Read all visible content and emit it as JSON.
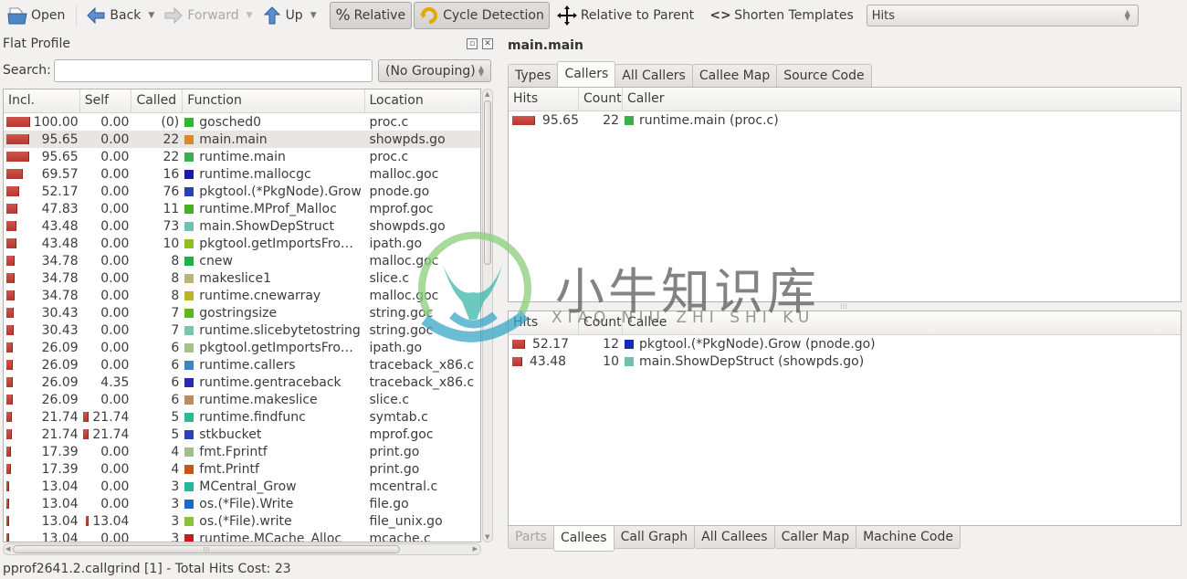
{
  "toolbar": {
    "open": "Open",
    "back": "Back",
    "forward": "Forward",
    "up": "Up",
    "relative": "Relative",
    "cycle_detection": "Cycle Detection",
    "relative_to_parent": "Relative to Parent",
    "shorten_templates": "Shorten Templates",
    "event_type": "Hits"
  },
  "flat_profile": {
    "title": "Flat Profile",
    "search_label": "Search:",
    "search_value": "",
    "grouping": "(No Grouping)",
    "columns": [
      "Incl.",
      "Self",
      "Called",
      "Function",
      "Location"
    ],
    "selected_row": 1,
    "rows": [
      {
        "incl": "100.00",
        "self": "0.00",
        "self_bar": 0,
        "called": "(0)",
        "function": "gosched0",
        "color": "#2fb52f",
        "location": "proc.c"
      },
      {
        "incl": "95.65",
        "self": "0.00",
        "self_bar": 0,
        "called": "22",
        "function": "main.main",
        "color": "#d88a2a",
        "location": "showpds.go"
      },
      {
        "incl": "95.65",
        "self": "0.00",
        "self_bar": 0,
        "called": "22",
        "function": "runtime.main",
        "color": "#3fae4f",
        "location": "proc.c"
      },
      {
        "incl": "69.57",
        "self": "0.00",
        "self_bar": 0,
        "called": "16",
        "function": "runtime.mallocgc",
        "color": "#1a1aa8",
        "location": "malloc.goc"
      },
      {
        "incl": "52.17",
        "self": "0.00",
        "self_bar": 0,
        "called": "76",
        "function": "pkgtool.(*PkgNode).Grow",
        "color": "#2a3fb0",
        "location": "pnode.go"
      },
      {
        "incl": "47.83",
        "self": "0.00",
        "self_bar": 0,
        "called": "11",
        "function": "runtime.MProf_Malloc",
        "color": "#4aae24",
        "location": "mprof.goc"
      },
      {
        "incl": "43.48",
        "self": "0.00",
        "self_bar": 0,
        "called": "73",
        "function": "main.ShowDepStruct",
        "color": "#6cc2ae",
        "location": "showpds.go"
      },
      {
        "incl": "43.48",
        "self": "0.00",
        "self_bar": 0,
        "called": "10",
        "function": "pkgtool.getImportsFro…",
        "color": "#8fbf1f",
        "location": "ipath.go"
      },
      {
        "incl": "34.78",
        "self": "0.00",
        "self_bar": 0,
        "called": "8",
        "function": "cnew",
        "color": "#1fb04a",
        "location": "malloc.goc"
      },
      {
        "incl": "34.78",
        "self": "0.00",
        "self_bar": 0,
        "called": "8",
        "function": "makeslice1",
        "color": "#b9b57a",
        "location": "slice.c"
      },
      {
        "incl": "34.78",
        "self": "0.00",
        "self_bar": 0,
        "called": "8",
        "function": "runtime.cnewarray",
        "color": "#b9b526",
        "location": "malloc.goc"
      },
      {
        "incl": "30.43",
        "self": "0.00",
        "self_bar": 0,
        "called": "7",
        "function": "gostringsize",
        "color": "#5cb81c",
        "location": "string.goc"
      },
      {
        "incl": "30.43",
        "self": "0.00",
        "self_bar": 0,
        "called": "7",
        "function": "runtime.slicebytetostring",
        "color": "#78c6b0",
        "location": "string.goc"
      },
      {
        "incl": "26.09",
        "self": "0.00",
        "self_bar": 0,
        "called": "6",
        "function": "pkgtool.getImportsFro…",
        "color": "#a5c08a",
        "location": "ipath.go"
      },
      {
        "incl": "26.09",
        "self": "0.00",
        "self_bar": 0,
        "called": "6",
        "function": "runtime.callers",
        "color": "#3a86c8",
        "location": "traceback_x86.c"
      },
      {
        "incl": "26.09",
        "self": "4.35",
        "self_bar": 0,
        "called": "6",
        "function": "runtime.gentraceback",
        "color": "#2a2ab0",
        "location": "traceback_x86.c"
      },
      {
        "incl": "26.09",
        "self": "0.00",
        "self_bar": 0,
        "called": "6",
        "function": "runtime.makeslice",
        "color": "#c08a5a",
        "location": "slice.c"
      },
      {
        "incl": "21.74",
        "self": "21.74",
        "self_bar": 21.74,
        "called": "5",
        "function": "runtime.findfunc",
        "color": "#2cb890",
        "location": "symtab.c"
      },
      {
        "incl": "21.74",
        "self": "21.74",
        "self_bar": 21.74,
        "called": "5",
        "function": "stkbucket",
        "color": "#2f3fb8",
        "location": "mprof.goc"
      },
      {
        "incl": "17.39",
        "self": "0.00",
        "self_bar": 0,
        "called": "4",
        "function": "fmt.Fprintf",
        "color": "#9fc08a",
        "location": "print.go"
      },
      {
        "incl": "17.39",
        "self": "0.00",
        "self_bar": 0,
        "called": "4",
        "function": "fmt.Printf",
        "color": "#c4561a",
        "location": "print.go"
      },
      {
        "incl": "13.04",
        "self": "0.00",
        "self_bar": 0,
        "called": "3",
        "function": "MCentral_Grow",
        "color": "#22b89a",
        "location": "mcentral.c"
      },
      {
        "incl": "13.04",
        "self": "0.00",
        "self_bar": 0,
        "called": "3",
        "function": "os.(*File).Write",
        "color": "#1a6ac8",
        "location": "file.go"
      },
      {
        "incl": "13.04",
        "self": "13.04",
        "self_bar": 13.04,
        "called": "3",
        "function": "os.(*File).write",
        "color": "#8cc23a",
        "location": "file_unix.go"
      },
      {
        "incl": "13.04",
        "self": "0.00",
        "self_bar": 0,
        "called": "3",
        "function": "runtime.MCache_Alloc",
        "color": "#c81a1a",
        "location": "mcache.c"
      }
    ]
  },
  "status_bar": "pprof2641.2.callgrind [1] - Total Hits Cost: 23",
  "detail": {
    "title": "main.main",
    "top_tabs": [
      {
        "label": "Types",
        "active": false,
        "disabled": false
      },
      {
        "label": "Callers",
        "active": true,
        "disabled": false
      },
      {
        "label": "All Callers",
        "active": false,
        "disabled": false
      },
      {
        "label": "Callee Map",
        "active": false,
        "disabled": false
      },
      {
        "label": "Source Code",
        "active": false,
        "disabled": false
      }
    ],
    "callers": {
      "columns": [
        "Hits",
        "Count",
        "Caller"
      ],
      "rows": [
        {
          "hits": "95.65",
          "count": "22",
          "name": "runtime.main (proc.c)",
          "color": "#3fae4f"
        }
      ]
    },
    "callees": {
      "columns": [
        "Hits",
        "Count",
        "Callee"
      ],
      "rows": [
        {
          "hits": "52.17",
          "count": "12",
          "name": "pkgtool.(*PkgNode).Grow (pnode.go)",
          "color": "#1a2ab8"
        },
        {
          "hits": "43.48",
          "count": "10",
          "name": "main.ShowDepStruct (showpds.go)",
          "color": "#6cc2ae"
        }
      ]
    },
    "bottom_tabs": [
      {
        "label": "Parts",
        "active": false,
        "disabled": true
      },
      {
        "label": "Callees",
        "active": true,
        "disabled": false
      },
      {
        "label": "Call Graph",
        "active": false,
        "disabled": false
      },
      {
        "label": "All Callees",
        "active": false,
        "disabled": false
      },
      {
        "label": "Caller Map",
        "active": false,
        "disabled": false
      },
      {
        "label": "Machine Code",
        "active": false,
        "disabled": false
      }
    ]
  },
  "watermark": {
    "text": "小牛知识库",
    "subtext": "XIAO NIU ZHI SHI KU"
  },
  "colors": {
    "cost_bar": "#c4423b",
    "selection": "#e8e6e3",
    "window_bg": "#f2f1f0"
  }
}
